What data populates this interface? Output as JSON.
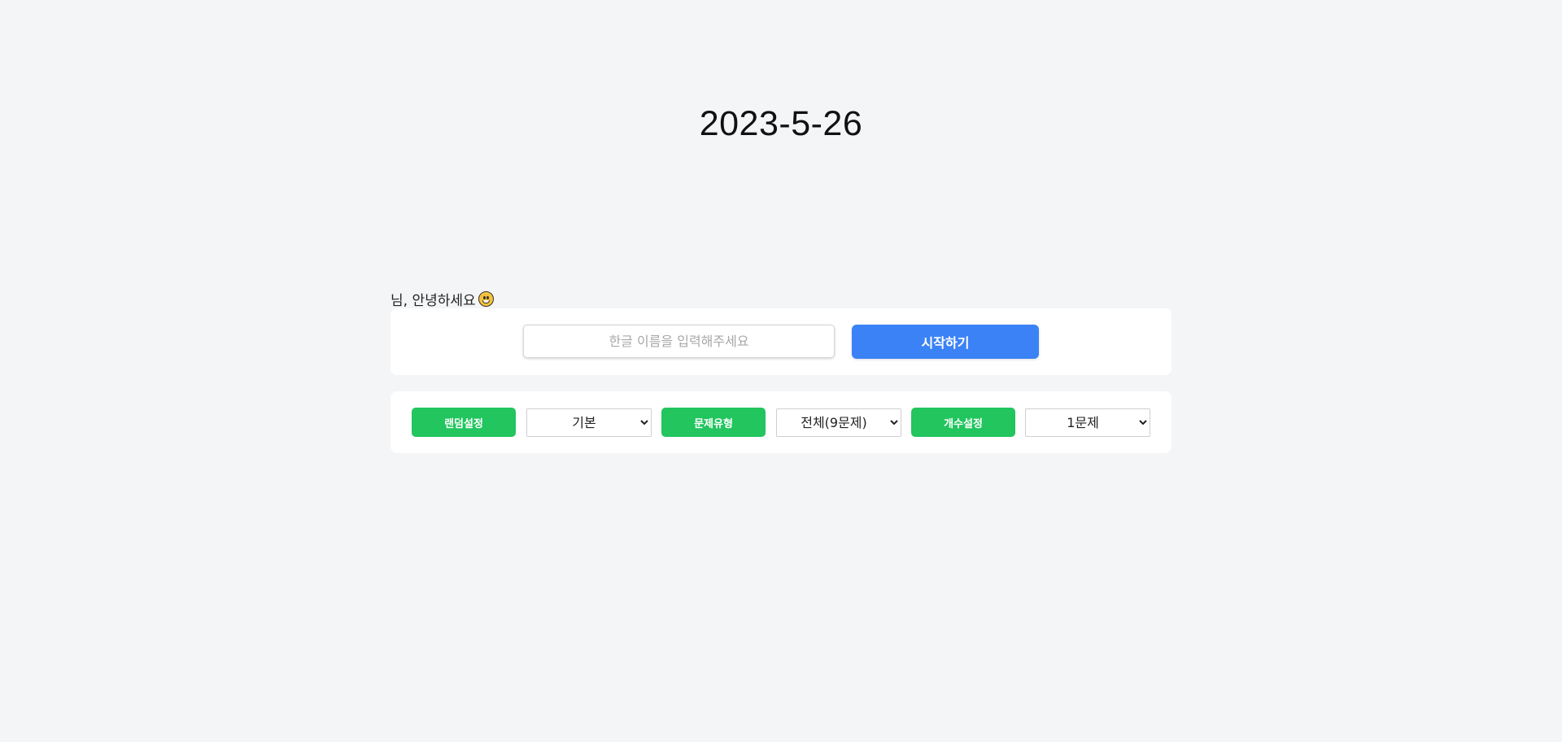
{
  "header": {
    "date": "2023-5-26"
  },
  "greeting": {
    "text": "님, 안녕하세요",
    "emoji_icon": "grinning-face-icon"
  },
  "name_form": {
    "input_value": "",
    "input_placeholder": "한글 이름을 입력해주세요",
    "start_label": "시작하기"
  },
  "settings": {
    "random": {
      "label": "랜덤설정",
      "selected": "기본"
    },
    "type": {
      "label": "문제유형",
      "selected": "전체(9문제)"
    },
    "count": {
      "label": "개수설정",
      "selected": "1문제"
    }
  },
  "colors": {
    "background": "#f4f5f7",
    "primary_blue": "#3b82f6",
    "accent_green": "#22c55e",
    "card": "#ffffff"
  }
}
